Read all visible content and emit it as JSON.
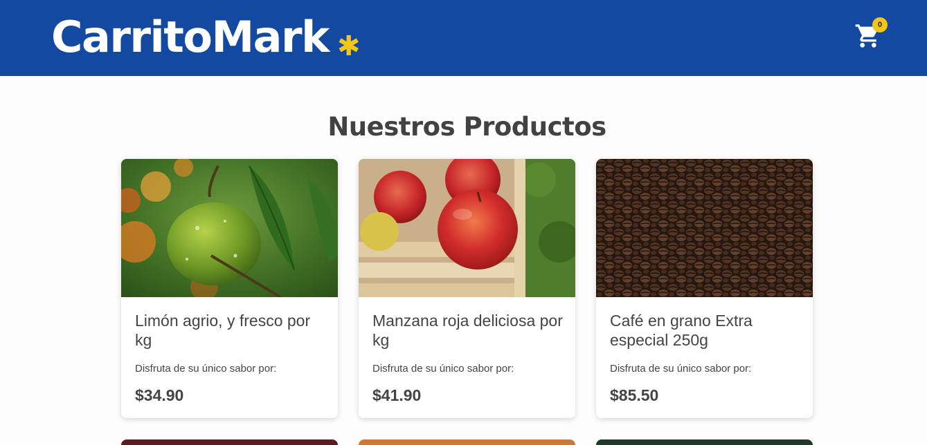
{
  "header": {
    "brand": "CarritoMark",
    "brand_mark": "✱",
    "cart_icon": "shopping-cart-icon",
    "cart_count": "0",
    "colors": {
      "bar": "#1349a0",
      "accent": "#f5c518"
    }
  },
  "main": {
    "title": "Nuestros Productos",
    "products": [
      {
        "name": "Limón agrio, y fresco por kg",
        "subtitle": "Disfruta de su único sabor por:",
        "price": "$34.90"
      },
      {
        "name": "Manzana roja deliciosa por kg",
        "subtitle": "Disfruta de su único sabor por:",
        "price": "$41.90"
      },
      {
        "name": "Café en grano Extra especial 250g",
        "subtitle": "Disfruta de su único sabor por:",
        "price": "$85.50"
      }
    ]
  }
}
